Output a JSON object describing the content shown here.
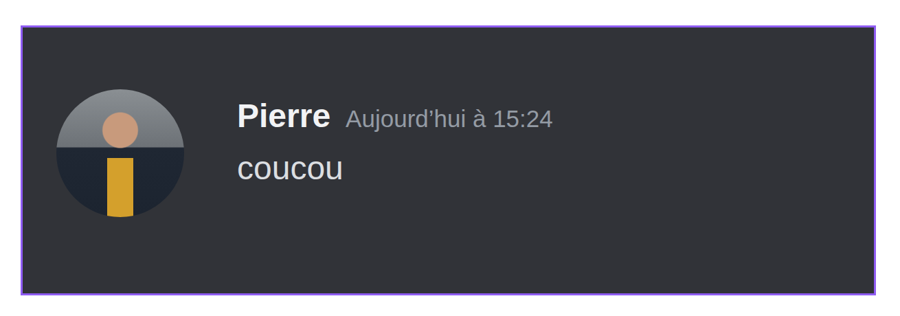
{
  "message": {
    "author": "Pierre",
    "timestamp": "Aujourd’hui à 15:24",
    "text": "coucou"
  }
}
